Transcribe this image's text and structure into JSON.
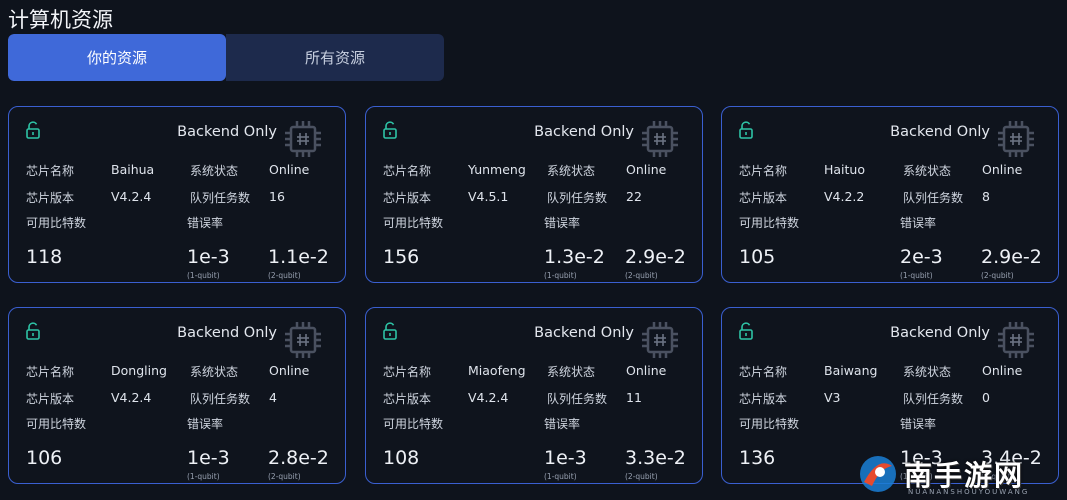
{
  "page_title": "计算机资源",
  "tabs": [
    {
      "label": "你的资源",
      "active": true
    },
    {
      "label": "所有资源",
      "active": false
    }
  ],
  "labels": {
    "backend": "Backend Only",
    "chip_name": "芯片名称",
    "chip_version": "芯片版本",
    "system_status": "系统状态",
    "queue_tasks": "队列任务数",
    "available_qubits": "可用比特数",
    "error_rate": "错误率",
    "one_qubit": "(1-qubit)",
    "two_qubit": "(2-qubit)"
  },
  "cards": [
    {
      "name": "Baihua",
      "version": "V4.2.4",
      "status": "Online",
      "queue": "16",
      "qubits": "118",
      "err1": "1e-3",
      "err2": "1.1e-2"
    },
    {
      "name": "Yunmeng",
      "version": "V4.5.1",
      "status": "Online",
      "queue": "22",
      "qubits": "156",
      "err1": "1.3e-2",
      "err2": "2.9e-2"
    },
    {
      "name": "Haituo",
      "version": "V4.2.2",
      "status": "Online",
      "queue": "8",
      "qubits": "105",
      "err1": "2e-3",
      "err2": "2.9e-2"
    },
    {
      "name": "Dongling",
      "version": "V4.2.4",
      "status": "Online",
      "queue": "4",
      "qubits": "106",
      "err1": "1e-3",
      "err2": "2.8e-2"
    },
    {
      "name": "Miaofeng",
      "version": "V4.2.4",
      "status": "Online",
      "queue": "11",
      "qubits": "108",
      "err1": "1e-3",
      "err2": "3.3e-2"
    },
    {
      "name": "Baiwang",
      "version": "V3",
      "status": "Online",
      "queue": "0",
      "qubits": "136",
      "err1": "1e-3",
      "err2": "3.4e-2"
    }
  ],
  "watermark": {
    "text": "南手游网",
    "subtext": "NUANANSHOUYOUWANG"
  },
  "colors": {
    "accent": "#3f69d9",
    "card_border": "#3a5fd0",
    "lock_icon": "#2ec4a6",
    "tab_inactive": "#1d2a4c"
  }
}
